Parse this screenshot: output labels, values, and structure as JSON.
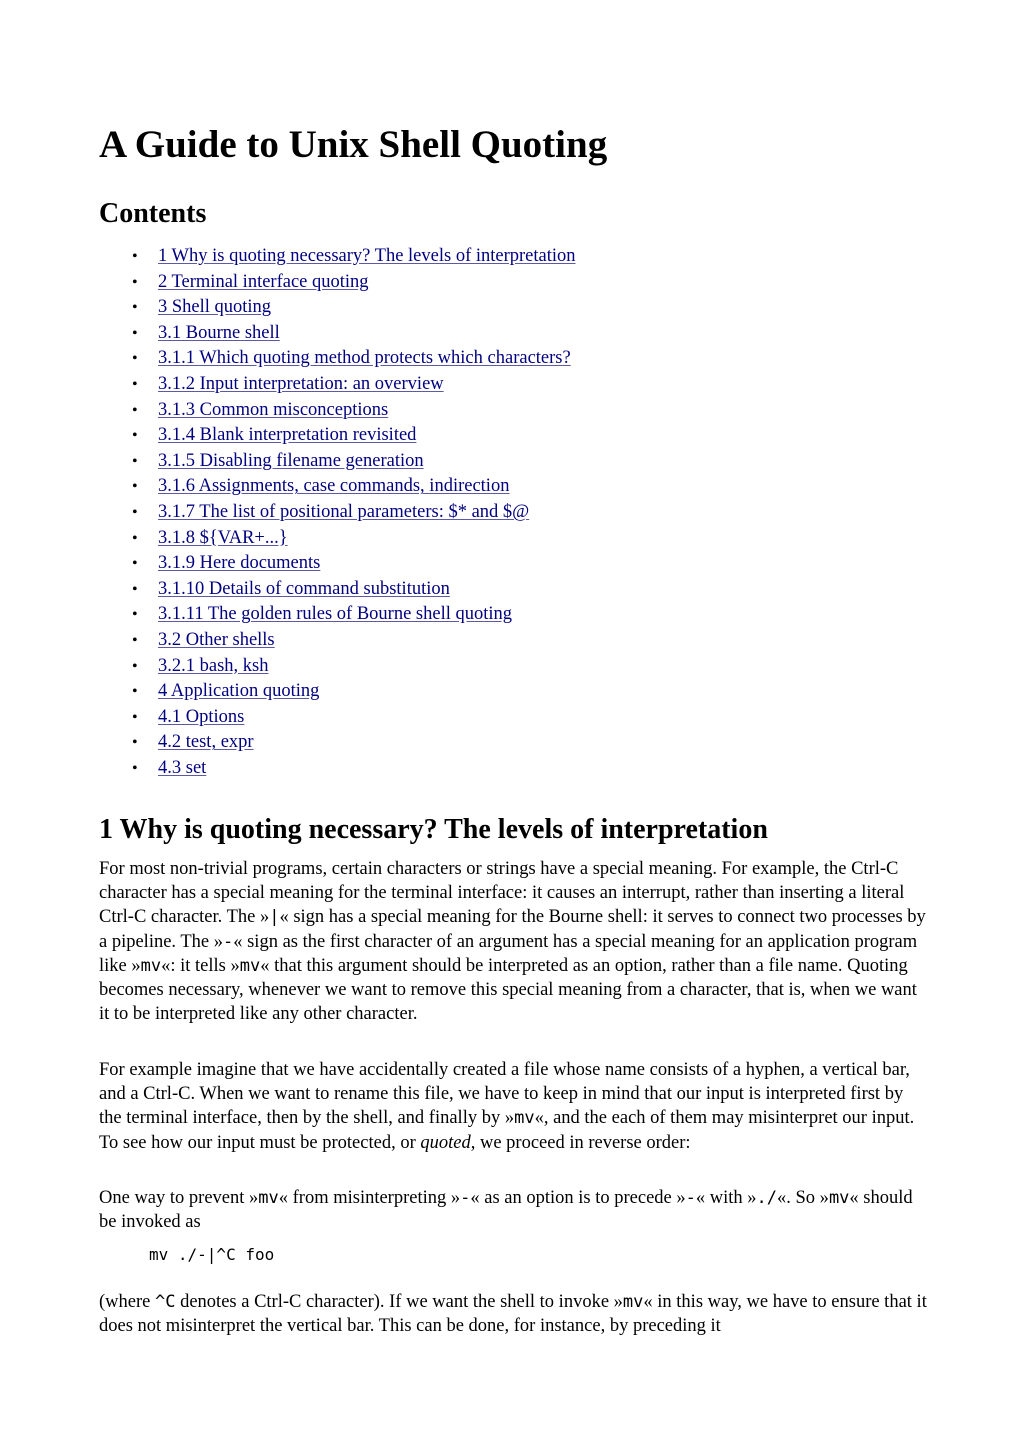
{
  "document": {
    "title": "A Guide to Unix Shell Quoting",
    "contents_heading": "Contents",
    "toc": [
      "1 Why is quoting necessary? The levels of interpretation",
      "2 Terminal interface quoting",
      "3 Shell quoting",
      "3.1 Bourne shell",
      "3.1.1 Which quoting method protects which characters?",
      "3.1.2 Input interpretation: an overview",
      "3.1.3 Common misconceptions",
      "3.1.4 Blank interpretation revisited",
      "3.1.5 Disabling filename generation",
      "3.1.6 Assignments, case commands, indirection",
      "3.1.7 The list of positional parameters: $* and $@",
      "3.1.8 ${VAR+...}",
      "3.1.9 Here documents",
      "3.1.10 Details of command substitution",
      "3.1.11 The golden rules of Bourne shell quoting",
      "3.2 Other shells",
      "3.2.1 bash, ksh",
      "4 Application quoting",
      "4.1 Options",
      "4.2 test, expr",
      "4.3 set"
    ],
    "bullet": "•",
    "section1": {
      "heading": "1 Why is quoting necessary? The levels of interpretation",
      "p1": {
        "t1": "For most non-trivial programs, certain characters or strings have a special meaning. For example, the Ctrl-C character has a special meaning for the terminal interface: it causes an interrupt, rather than inserting a literal Ctrl-C character. The »",
        "c1": "|",
        "t2": "« sign has a special meaning for the Bourne shell: it serves to connect two processes by a pipeline. The »",
        "c2": "-",
        "t3": "« sign as the first character of an argument has a special meaning for an application program like »",
        "c3": "mv",
        "t4": "«: it tells »",
        "c4": "mv",
        "t5": "« that this argument should be interpreted as an option, rather than a file name. Quoting becomes necessary, whenever we want to remove this special meaning from a character, that is, when we want it to be interpreted like any other character."
      },
      "p2": {
        "t1": "For example imagine that we have accidentally created a file whose name consists of a hyphen, a vertical bar, and a Ctrl-C. When we want to rename this file, we have to keep in mind that our input is interpreted first by the terminal interface, then by the shell, and finally by »",
        "c1": "mv",
        "t2": "«, and the each of them may misinterpret our input. To see how our input must be protected, or ",
        "em": "quoted",
        "t3": ", we proceed in reverse order:"
      },
      "p3": {
        "t1": "One way to prevent »",
        "c1": "mv",
        "t2": "« from misinterpreting »",
        "c2": "-",
        "t3": "« as an option is to precede »",
        "c3": "-",
        "t4": "« with »",
        "c4": "./",
        "t5": "«. So »",
        "c5": "mv",
        "t6": "« should be invoked as"
      },
      "code": "mv ./-|^C foo",
      "p4": {
        "t1": "(where ",
        "c1": "^C",
        "t2": " denotes a Ctrl-C character). If we want the shell to invoke »",
        "c2": "mv",
        "t3": "« in this way, we have to ensure that it does not misinterpret the vertical bar. This can be done, for instance, by preceding it"
      }
    }
  }
}
